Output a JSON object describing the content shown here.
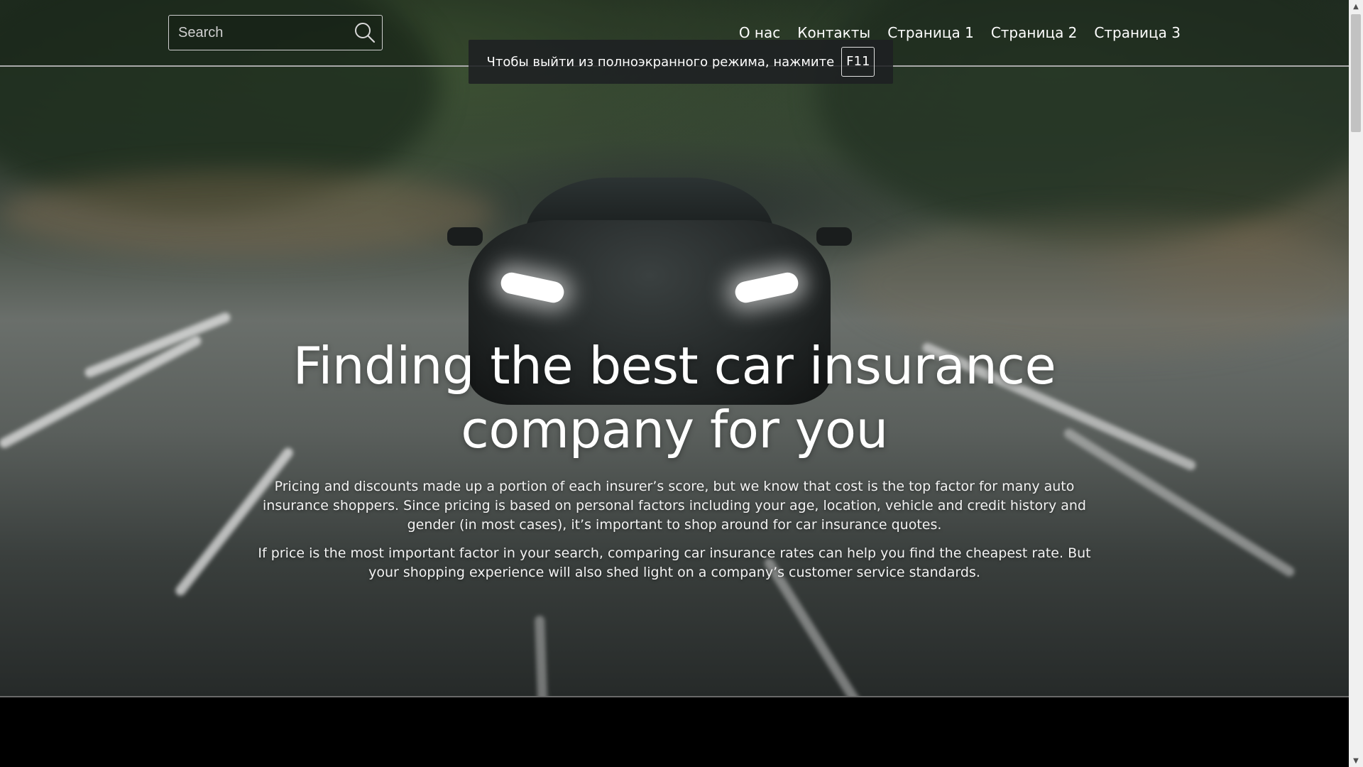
{
  "search": {
    "placeholder": "Search",
    "icon": "search-icon"
  },
  "nav": {
    "items": [
      {
        "label": "О нас"
      },
      {
        "label": "Контакты"
      },
      {
        "label": "Страница 1"
      },
      {
        "label": "Страница 2"
      },
      {
        "label": "Страница 3"
      }
    ]
  },
  "fullscreen_notice": {
    "text": "Чтобы выйти из полноэкранного режима, нажмите",
    "key": "F11"
  },
  "hero": {
    "heading_line1": "Finding the best car insurance",
    "heading_line2": "company for you",
    "paragraph1": "Pricing and discounts made up a portion of each insurer’s score, but we know that cost is the top factor for many auto insurance shoppers. Since pricing is based on personal factors including your age, location, vehicle and credit history and gender (in most cases), it’s important to shop around for car insurance quotes.",
    "paragraph2": "If price is the most important factor in your search, comparing car insurance rates can help you find the cheapest rate. But your shopping experience will also shed light on a company’s customer service standards."
  },
  "colors": {
    "text": "#ffffff",
    "footer": "#000000"
  }
}
